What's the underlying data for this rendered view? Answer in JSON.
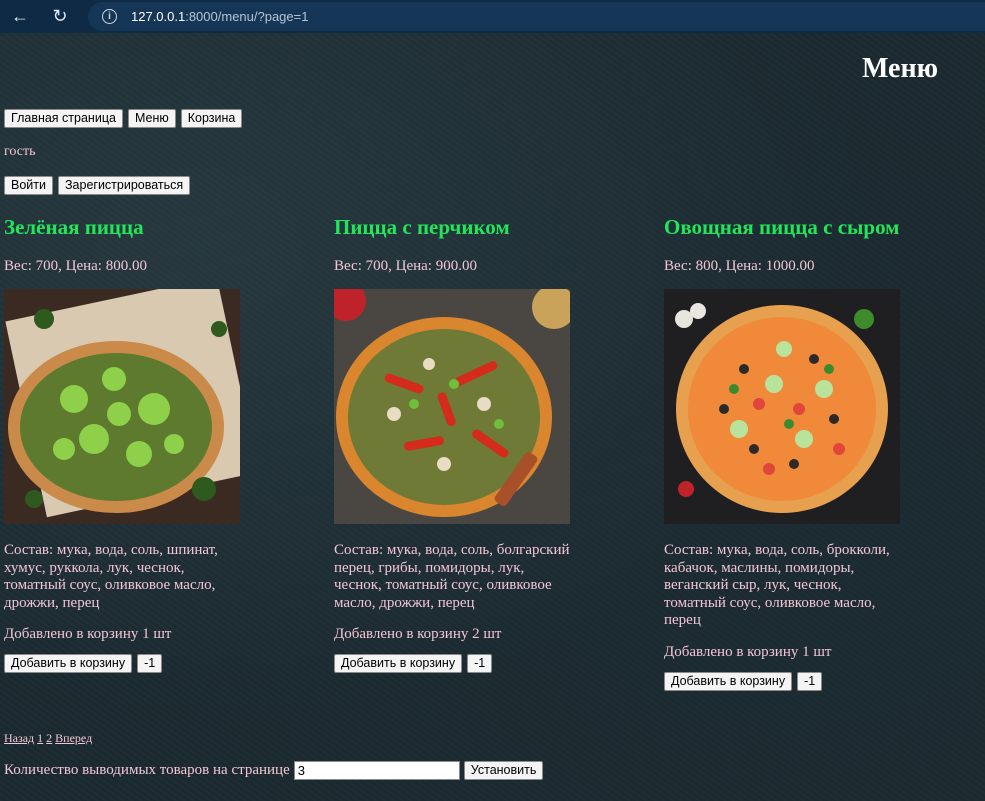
{
  "browser": {
    "url_host": "127.0.0.1",
    "url_rest": ":8000/menu/?page=1"
  },
  "page": {
    "title": "Меню"
  },
  "nav": {
    "home": "Главная страница",
    "menu": "Меню",
    "cart": "Корзина"
  },
  "user": {
    "name": "гость"
  },
  "auth": {
    "login": "Войти",
    "register": "Зарегистрироваться"
  },
  "products": [
    {
      "title": "Зелёная пицца",
      "meta": "Вес: 700, Цена: 800.00",
      "composition": "Состав: мука, вода, соль, шпинат, хумус, руккола, лук, чеснок, томатный соус, оливковое масло, дрожжи, перец",
      "in_cart": "Добавлено в корзину 1 шт",
      "add_label": "Добавить в корзину",
      "minus_label": "-1"
    },
    {
      "title": "Пицца с перчиком",
      "meta": "Вес: 700, Цена: 900.00",
      "composition": "Состав: мука, вода, соль, болгарский перец, грибы, помидоры, лук, чеснок, томатный соус, оливковое масло, дрожжи, перец",
      "in_cart": "Добавлено в корзину 2 шт",
      "add_label": "Добавить в корзину",
      "minus_label": "-1"
    },
    {
      "title": "Овощная пицца с сыром",
      "meta": "Вес: 800, Цена: 1000.00",
      "composition": "Состав: мука, вода, соль, брокколи, кабачок, маслины, помидоры, веганский сыр, лук, чеснок, томатный соус, оливковое масло, перец",
      "in_cart": "Добавлено в корзину 1 шт",
      "add_label": "Добавить в корзину",
      "minus_label": "-1"
    }
  ],
  "pager": {
    "prev": "Назад",
    "page1": "1",
    "page2": "2",
    "next": "Вперед"
  },
  "per_page": {
    "label": "Количество выводимых товаров на странице",
    "value": "3",
    "submit": "Установить"
  }
}
